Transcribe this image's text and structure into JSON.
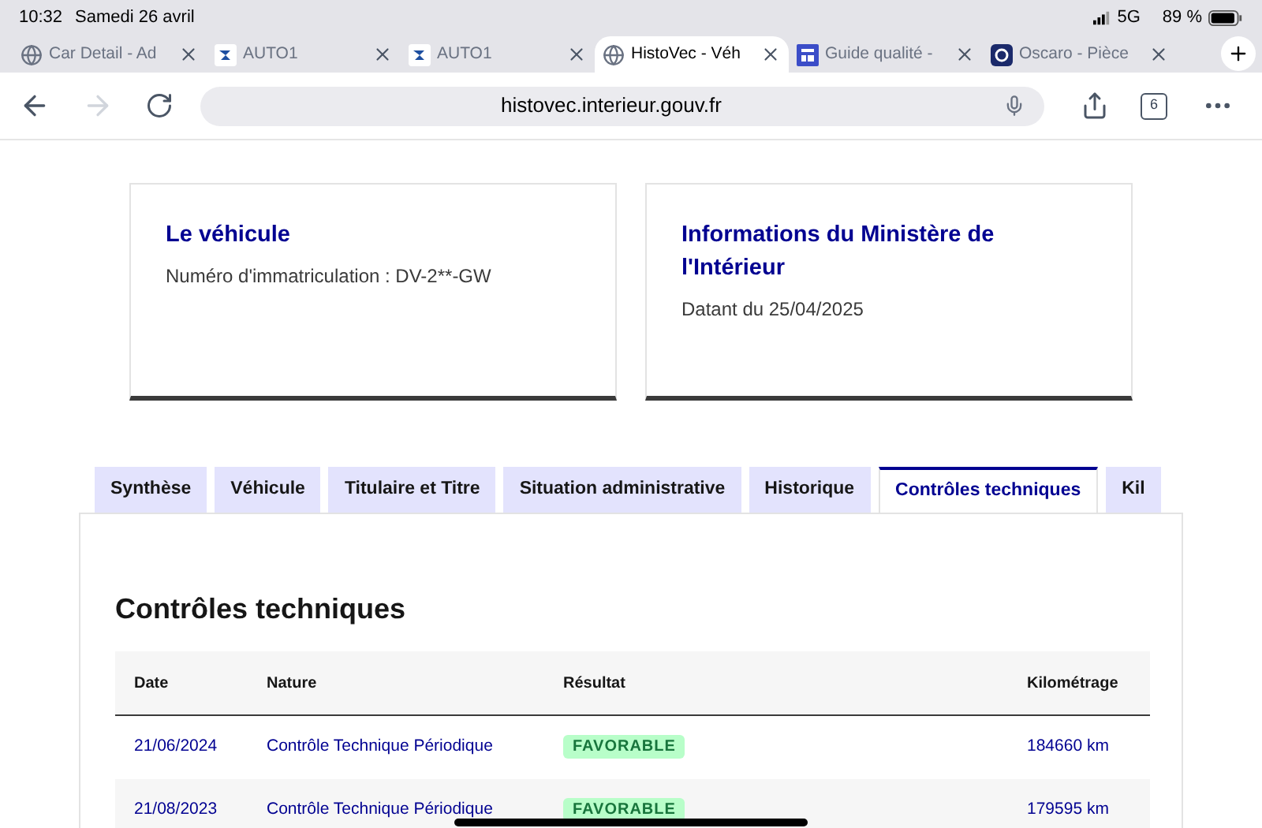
{
  "status_bar": {
    "time": "10:32",
    "date": "Samedi 26 avril",
    "network": "5G",
    "battery": "89 %"
  },
  "browser_tabs": [
    {
      "title": "Car Detail - Ad",
      "kind": "globe",
      "selected": false
    },
    {
      "title": "AUTO1",
      "kind": "auto",
      "selected": false
    },
    {
      "title": "AUTO1",
      "kind": "auto",
      "selected": false
    },
    {
      "title": "HistoVec - Véh",
      "kind": "globe",
      "selected": true
    },
    {
      "title": "Guide qualité -",
      "kind": "doc",
      "selected": false
    },
    {
      "title": "Oscaro - Pièce",
      "kind": "oscaro",
      "selected": false
    }
  ],
  "address_bar": {
    "url": "histovec.interieur.gouv.fr"
  },
  "tab_count": "6",
  "cards": [
    {
      "title": "Le véhicule",
      "text": "Numéro d'immatriculation : DV-2**-GW"
    },
    {
      "title": "Informations du Ministère de l'Intérieur",
      "text": "Datant du 25/04/2025"
    }
  ],
  "page_tabs": [
    {
      "label": "Synthèse",
      "selected": false
    },
    {
      "label": "Véhicule",
      "selected": false
    },
    {
      "label": "Titulaire et Titre",
      "selected": false
    },
    {
      "label": "Situation administrative",
      "selected": false
    },
    {
      "label": "Historique",
      "selected": false
    },
    {
      "label": "Contrôles techniques",
      "selected": true
    },
    {
      "label": "Kil",
      "selected": false
    }
  ],
  "section_title": "Contrôles techniques",
  "table": {
    "columns": [
      "Date",
      "Nature",
      "Résultat",
      "Kilométrage"
    ],
    "rows": [
      {
        "date": "21/06/2024",
        "nature": "Contrôle Technique Périodique",
        "result": "FAVORABLE",
        "mileage": "184660 km"
      },
      {
        "date": "21/08/2023",
        "nature": "Contrôle Technique Périodique",
        "result": "FAVORABLE",
        "mileage": "179595 km"
      }
    ]
  }
}
